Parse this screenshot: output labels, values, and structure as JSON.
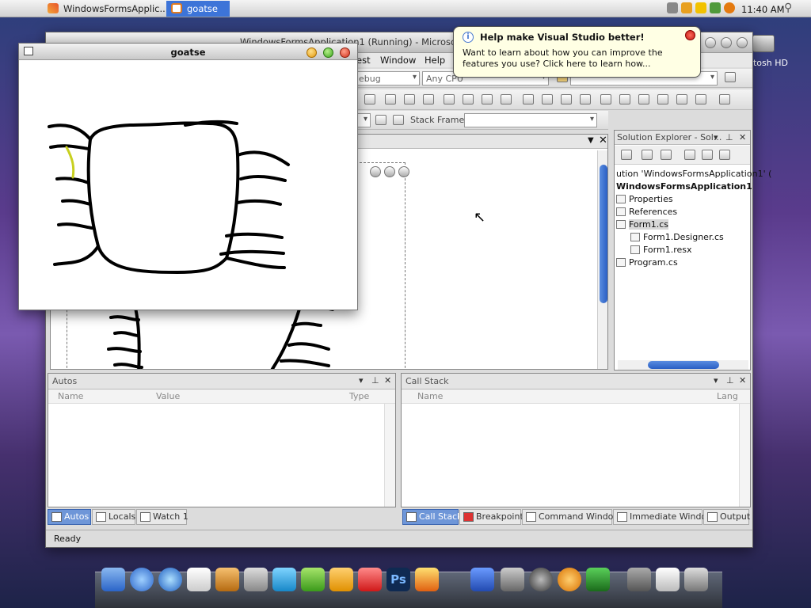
{
  "menubar": {
    "tab1_label": "WindowsFormsApplic...",
    "tab2_label": "goatse",
    "clock": "11:40 AM"
  },
  "desktop": {
    "hd_label": "ntosh HD"
  },
  "vs": {
    "title": "WindowsFormsApplication1 (Running) - Microso",
    "menu": [
      "est",
      "Window",
      "Help"
    ],
    "config_combo": "ebug",
    "platform_combo": "Any CPU",
    "stack_frame_label": "Stack Frame:",
    "status": "Ready"
  },
  "balloon": {
    "title": "Help make Visual Studio better!",
    "body": "Want to learn about how you can improve the features you use? Click here to learn how..."
  },
  "solution_explorer": {
    "title": "Solution Explorer - Sol...",
    "items": [
      "ution 'WindowsFormsApplication1' (",
      "WindowsFormsApplication1",
      "Properties",
      "References",
      "Form1.cs",
      "Form1.Designer.cs",
      "Form1.resx",
      "Program.cs"
    ]
  },
  "autos": {
    "title": "Autos",
    "columns": [
      "Name",
      "Value",
      "Type"
    ]
  },
  "callstack": {
    "title": "Call Stack",
    "columns": [
      "Name",
      "Lang"
    ]
  },
  "bottom_tabs_left": [
    "Autos",
    "Locals",
    "Watch 1"
  ],
  "bottom_tabs_right": [
    "Call Stack",
    "Breakpoints",
    "Command Window",
    "Immediate Window",
    "Output"
  ],
  "app": {
    "title": "goatse"
  },
  "dock": {
    "icons": [
      "finder-icon",
      "safari-icon",
      "quicktime-icon",
      "textedit-icon",
      "apps-icon",
      "calculator-icon",
      "wc-icon",
      "kp-icon",
      "p-icon",
      "a-icon",
      "photoshop-icon",
      "cross-icon",
      "app-icon",
      "settings-icon",
      "power-icon",
      "search-icon",
      "chart-icon",
      "down-icon",
      "mail-icon",
      "trash-icon"
    ],
    "ps_label": "Ps"
  },
  "colors": {
    "menubar_active": "#3d74d8",
    "scroll_thumb": "#2a5fc4",
    "tab_active": "#6e96d8",
    "balloon_bg": "#ffffe4"
  }
}
